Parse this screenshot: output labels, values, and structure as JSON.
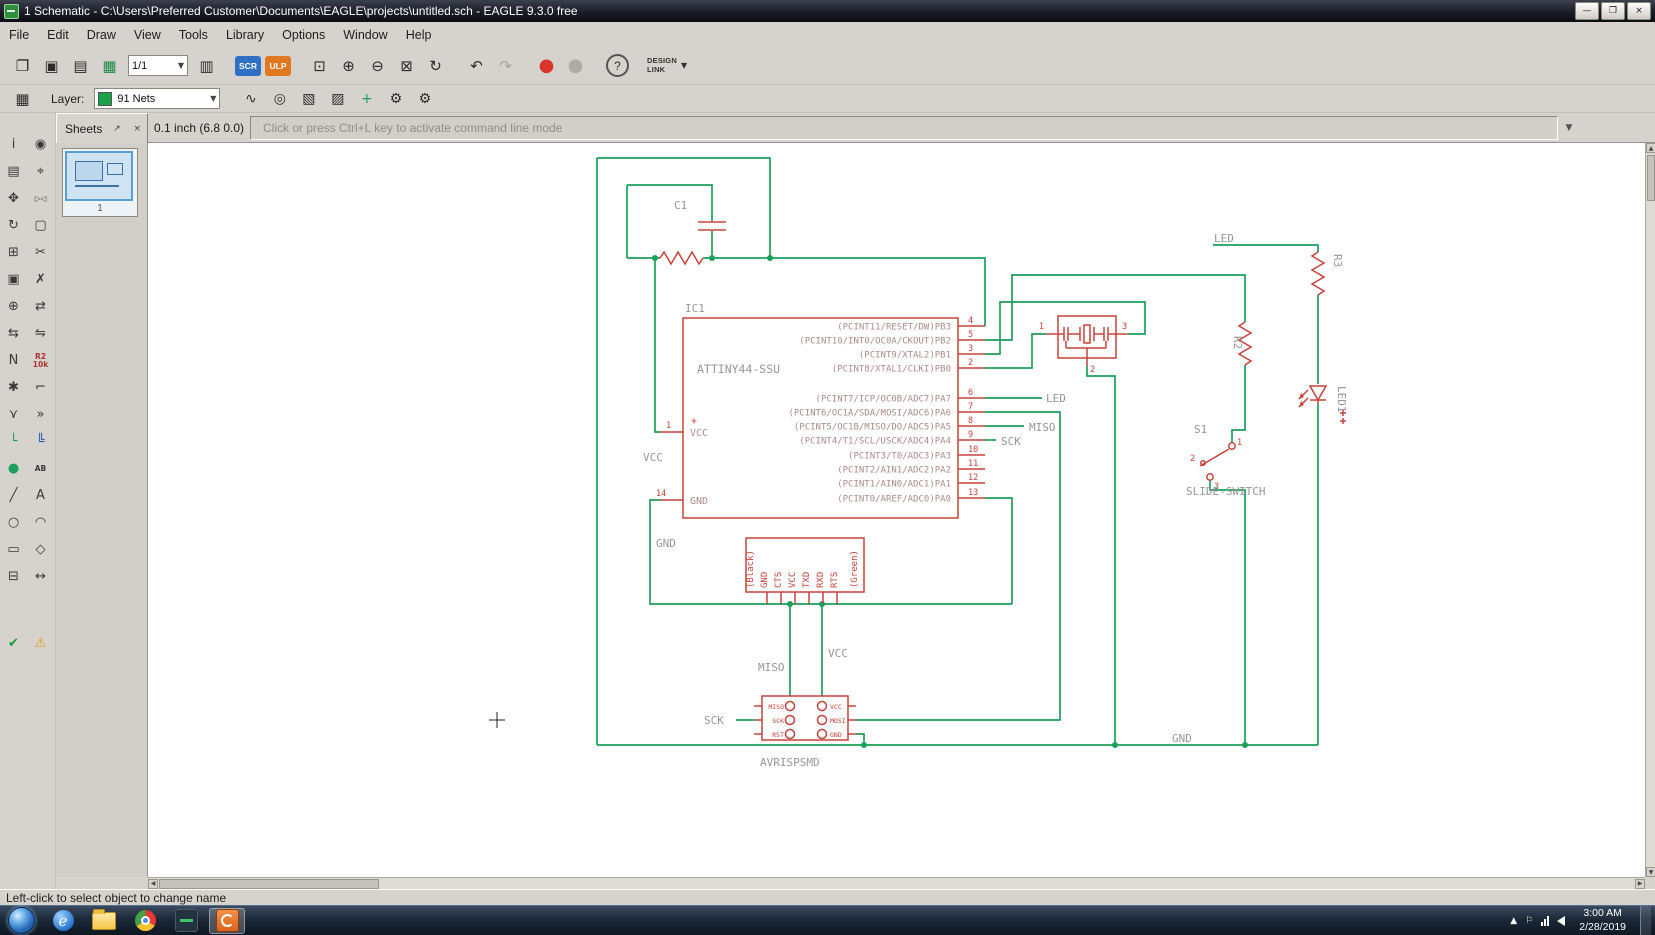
{
  "window": {
    "title": "1 Schematic - C:\\Users\\Preferred Customer\\Documents\\EAGLE\\projects\\untitled.sch - EAGLE 9.3.0 free",
    "minimize": "—",
    "maximize": "❐",
    "close": "×"
  },
  "menubar": {
    "items": [
      "File",
      "Edit",
      "Draw",
      "View",
      "Tools",
      "Library",
      "Options",
      "Window",
      "Help"
    ]
  },
  "toolbar1": {
    "open_glyph": "❐",
    "save_glyph": "▣",
    "print_glyph": "▤",
    "board_glyph": "▦",
    "sheet_value": "1/1",
    "caret": "▼",
    "cam_glyph": "▥",
    "scr": "SCR",
    "ulp": "ULP",
    "zoom_fit": "⊡",
    "zoom_in": "⊕",
    "zoom_out": "⊖",
    "zoom_select": "⊠",
    "zoom_redraw": "↻",
    "undo": "↶",
    "redo": "↷",
    "stop": "●",
    "go": "●",
    "help": "?",
    "design_line1": "DESIGN",
    "design_line2": "LINK"
  },
  "toolbar2": {
    "grid_glyph": "▦",
    "layer_label": "Layer:",
    "layer_value": "91 Nets",
    "layer_swatch_color": "#1aa24a",
    "caret": "▼",
    "buttons": [
      {
        "name": "bend-style-button",
        "glyph": "∿"
      },
      {
        "name": "wire-miter-button",
        "glyph": "◎"
      },
      {
        "name": "pattern-a-button",
        "glyph": "▧"
      },
      {
        "name": "pattern-b-button",
        "glyph": "▨"
      },
      {
        "name": "add-junction-button",
        "glyph": "+",
        "color": "#1aa05c"
      },
      {
        "name": "net-settings-button",
        "glyph": "⚙"
      },
      {
        "name": "class-settings-button",
        "glyph": "⚙"
      }
    ]
  },
  "panel": {
    "tab": "Sheets",
    "pin": "↗",
    "close": "×",
    "thumb_label": "1"
  },
  "commandbar": {
    "coords": "0.1 inch (6.8 0.0)",
    "placeholder": "Click or press Ctrl+L key to activate command line mode",
    "caret": "▼"
  },
  "left_toolbar": {
    "items": [
      {
        "name": "info-tool",
        "glyph": "i"
      },
      {
        "name": "show-tool",
        "glyph": "◉"
      },
      {
        "name": "display-tool",
        "glyph": "▤"
      },
      {
        "name": "mark-tool",
        "glyph": "⌖"
      },
      {
        "name": "move-tool",
        "glyph": "✥"
      },
      {
        "name": "mirror-tool",
        "glyph": "▷◁",
        "small": true
      },
      {
        "name": "rotate-tool",
        "glyph": "↻"
      },
      {
        "name": "group-tool",
        "glyph": "▢"
      },
      {
        "name": "copy-tool",
        "glyph": "⊞"
      },
      {
        "name": "cut-tool",
        "glyph": "✂"
      },
      {
        "name": "paste-tool",
        "glyph": "▣"
      },
      {
        "name": "delete-tool",
        "glyph": "✗"
      },
      {
        "name": "add-part-tool",
        "glyph": "⊕"
      },
      {
        "name": "pinswap-tool",
        "glyph": "⇄"
      },
      {
        "name": "gateswap-tool",
        "glyph": "⇆"
      },
      {
        "name": "replace-tool",
        "glyph": "⇋"
      },
      {
        "name": "name-tool",
        "glyph": "N"
      },
      {
        "name": "value-tool",
        "glyph": "R2\n10k",
        "small": true,
        "color": "#b03030"
      },
      {
        "name": "smash-tool",
        "glyph": "✱"
      },
      {
        "name": "miter-tool",
        "glyph": "⌐"
      },
      {
        "name": "split-tool",
        "glyph": "⋎"
      },
      {
        "name": "invoke-tool",
        "glyph": "»"
      },
      {
        "name": "net-tool",
        "glyph": "└",
        "color": "#1aa05c"
      },
      {
        "name": "bus-tool",
        "glyph": "╚",
        "color": "#2b5fad"
      },
      {
        "name": "junction-tool",
        "glyph": "●",
        "color": "#1aa05c"
      },
      {
        "name": "label-tool",
        "glyph": "AB",
        "small": true
      },
      {
        "name": "wire-tool",
        "glyph": "╱"
      },
      {
        "name": "text-tool",
        "glyph": "A"
      },
      {
        "name": "circle-tool",
        "glyph": "○"
      },
      {
        "name": "arc-tool",
        "glyph": "◠"
      },
      {
        "name": "rect-tool",
        "glyph": "▭"
      },
      {
        "name": "polygon-tool",
        "glyph": "◇"
      },
      {
        "name": "attribute-tool",
        "glyph": "⊟"
      },
      {
        "name": "dimension-tool",
        "glyph": "↔"
      }
    ],
    "bottom_items": [
      {
        "name": "erc-tool",
        "glyph": "✔",
        "color": "#1a9a3a"
      },
      {
        "name": "errors-tool",
        "glyph": "⚠",
        "color": "#d8a000"
      }
    ]
  },
  "statusbar": {
    "text": "Left-click to select object to change name"
  },
  "taskbar": {
    "ie_glyph": "e",
    "chevron": "▲",
    "flag": "⚐",
    "time": "3:00 AM",
    "date": "2/28/2019"
  },
  "scroll": {
    "up": "▲",
    "down": "▼",
    "left": "◀",
    "right": "▶"
  },
  "schematic": {
    "ic": {
      "name": "IC1",
      "value": "ATTINY44-SSU",
      "plus": "+",
      "left_pins": [
        {
          "label": "VCC",
          "number": "1"
        },
        {
          "label": "GND",
          "number": "14"
        }
      ],
      "right_pins": [
        {
          "label": "(PCINT11/RESET/DW)PB3",
          "number": "4"
        },
        {
          "label": "(PCINT10/INT0/OC0A/CKOUT)PB2",
          "number": "5"
        },
        {
          "label": "(PCINT9/XTAL2)PB1",
          "number": "3"
        },
        {
          "label": "(PCINT8/XTAL1/CLKI)PB0",
          "number": "2"
        },
        {
          "label": "(PCINT7/ICP/OC0B/ADC7)PA7",
          "number": "6"
        },
        {
          "label": "(PCINT6/OC1A/SDA/MOSI/ADC6)PA6",
          "number": "7"
        },
        {
          "label": "(PCINT5/OC1B/MISO/DO/ADC5)PA5",
          "number": "8"
        },
        {
          "label": "(PCINT4/T1/SCL/USCK/ADC4)PA4",
          "number": "9"
        },
        {
          "label": "(PCINT3/T0/ADC3)PA3",
          "number": "10"
        },
        {
          "label": "(PCINT2/AIN1/ADC2)PA2",
          "number": "11"
        },
        {
          "label": "(PCINT1/AIN0/ADC1)PA1",
          "number": "12"
        },
        {
          "label": "(PCINT0/AREF/ADC0)PA0",
          "number": "13"
        }
      ]
    },
    "parts": {
      "c1": "C1",
      "r2": "R2",
      "r3": "R3",
      "led1": "LED1",
      "s1": "S1",
      "slide_switch": "SLIDE-SWITCH",
      "avrisp": "AVRISPSMD"
    },
    "net_labels": {
      "vcc_left": "VCC",
      "gnd_left": "GND",
      "led_pin": "LED",
      "miso_pin": "MISO",
      "sck_pin": "SCK",
      "vcc_isp": "VCC",
      "miso_isp": "MISO",
      "sck_isp": "SCK",
      "gnd_rail": "GND",
      "led_top": "LED"
    },
    "resonator_pins": {
      "p1": "1",
      "p2": "2",
      "p3": "3"
    },
    "s1_pins": {
      "p1": "1",
      "p2": "2",
      "p3": "3"
    },
    "ftdi_labels": [
      "(Black)",
      "GND",
      "CTS",
      "VCC",
      "TXD",
      "RXD",
      "RTS",
      "(Green)"
    ],
    "avrisp_left": [
      "MISO",
      "SCK",
      "RST"
    ],
    "avrisp_right": [
      "VCC",
      "MOSI",
      "GND"
    ],
    "colors": {
      "net": "#1ba05c",
      "symbol": "#c8423a",
      "name": "#979797",
      "pin": "#aa8d8a"
    }
  }
}
